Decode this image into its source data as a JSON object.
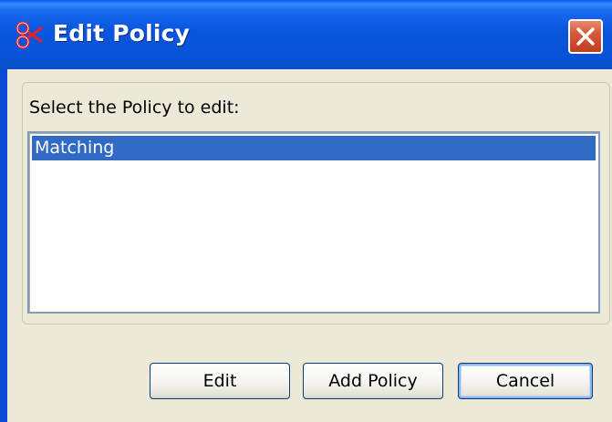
{
  "window": {
    "title": "Edit Policy",
    "icon": "policy-scissors-icon",
    "close_icon": "close-x-icon"
  },
  "dialog": {
    "prompt": "Select the Policy to edit:",
    "policies": [
      {
        "label": "Matching",
        "selected": true
      }
    ]
  },
  "buttons": {
    "edit": "Edit",
    "add_policy": "Add Policy",
    "cancel": "Cancel"
  },
  "colors": {
    "titlebar": "#0a58e0",
    "selection": "#316ac5",
    "dialog_bg": "#ece9d8",
    "close_button": "#d65a38"
  }
}
